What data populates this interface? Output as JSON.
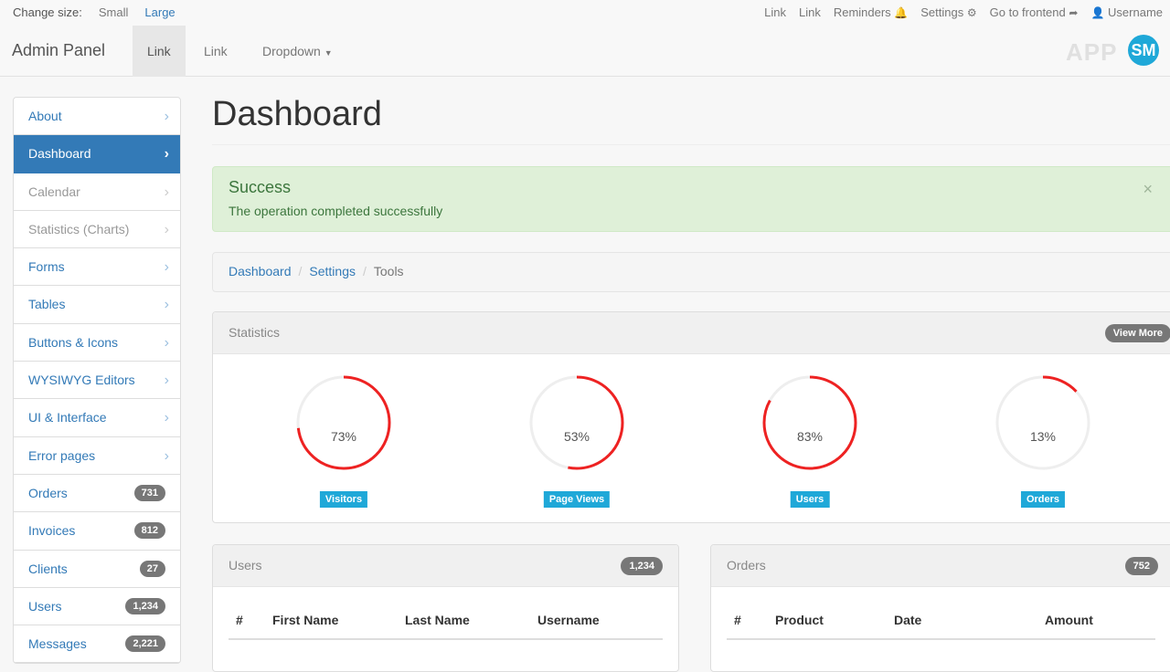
{
  "topbar": {
    "change_size_label": "Change size:",
    "small": "Small",
    "large": "Large",
    "right_links": [
      {
        "label": "Link",
        "icon": ""
      },
      {
        "label": "Link",
        "icon": ""
      },
      {
        "label": "Reminders",
        "icon": "bell-icon"
      },
      {
        "label": "Settings",
        "icon": "gear-icon"
      },
      {
        "label": "Go to frontend",
        "icon": "share-arrow-icon"
      },
      {
        "label": "Username",
        "icon": "user-icon"
      }
    ]
  },
  "navbar": {
    "brand": "Admin Panel",
    "links": [
      "Link",
      "Link",
      "Dropdown"
    ],
    "logo_text": "APP",
    "logo_mark": "SM"
  },
  "sidebar": {
    "items": [
      {
        "label": "About",
        "state": "normal",
        "badge": ""
      },
      {
        "label": "Dashboard",
        "state": "active",
        "badge": ""
      },
      {
        "label": "Calendar",
        "state": "disabled",
        "badge": ""
      },
      {
        "label": "Statistics (Charts)",
        "state": "disabled",
        "badge": ""
      },
      {
        "label": "Forms",
        "state": "normal",
        "badge": ""
      },
      {
        "label": "Tables",
        "state": "normal",
        "badge": ""
      },
      {
        "label": "Buttons & Icons",
        "state": "normal",
        "badge": ""
      },
      {
        "label": "WYSIWYG Editors",
        "state": "normal",
        "badge": ""
      },
      {
        "label": "UI & Interface",
        "state": "normal",
        "badge": ""
      },
      {
        "label": "Error pages",
        "state": "normal",
        "badge": ""
      },
      {
        "label": "Orders",
        "state": "badge",
        "badge": "731"
      },
      {
        "label": "Invoices",
        "state": "badge",
        "badge": "812"
      },
      {
        "label": "Clients",
        "state": "badge",
        "badge": "27"
      },
      {
        "label": "Users",
        "state": "badge",
        "badge": "1,234"
      },
      {
        "label": "Messages",
        "state": "badge",
        "badge": "2,221"
      }
    ]
  },
  "page": {
    "title": "Dashboard"
  },
  "alert": {
    "title": "Success",
    "message": "The operation completed successfully",
    "close": "×"
  },
  "breadcrumb": {
    "items": [
      "Dashboard",
      "Settings"
    ],
    "current": "Tools",
    "separator": "/"
  },
  "statistics": {
    "title": "Statistics",
    "button": "View More",
    "gauges": [
      {
        "value": 73,
        "label": "Visitors",
        "text": "73%"
      },
      {
        "value": 53,
        "label": "Page Views",
        "text": "53%"
      },
      {
        "value": 83,
        "label": "Users",
        "text": "83%"
      },
      {
        "value": 13,
        "label": "Orders",
        "text": "13%"
      }
    ],
    "gauge_color": "#ee2222",
    "label_color": "#1fa8d8"
  },
  "users_panel": {
    "title": "Users",
    "badge": "1,234",
    "columns": [
      "#",
      "First Name",
      "Last Name",
      "Username"
    ]
  },
  "orders_panel": {
    "title": "Orders",
    "badge": "752",
    "columns": [
      "#",
      "Product",
      "Date",
      "Amount"
    ]
  }
}
